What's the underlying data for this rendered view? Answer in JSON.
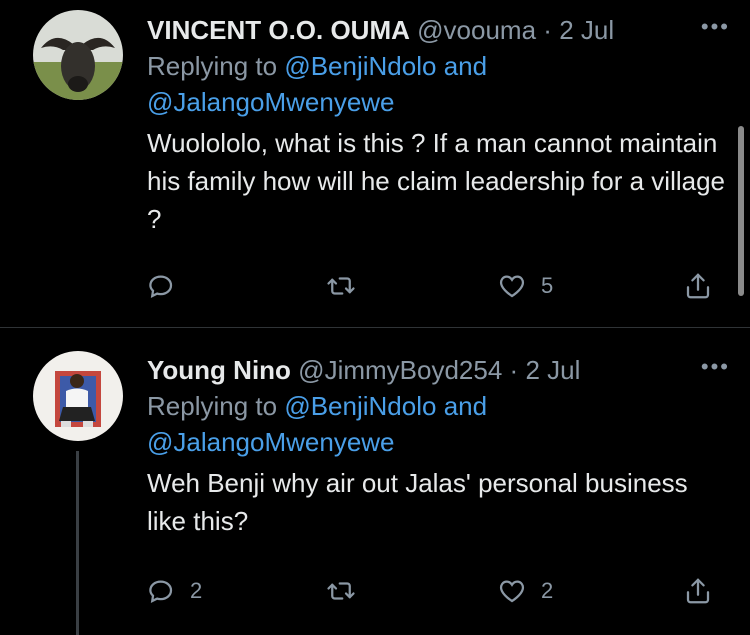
{
  "tweets": [
    {
      "name": "VINCENT O.O. OUMA",
      "handle": "@voouma",
      "separator": "·",
      "date": "2 Jul",
      "more": "•••",
      "replying_prefix": "Replying to",
      "mention1": "@BenjiNdolo",
      "connector": "and",
      "mention2": "@JalangoMwenyewe",
      "text": "Wuolololo, what is this ? If a man cannot maintain his family how will he claim leadership for a village ?",
      "reply_count": "",
      "retweet_count": "",
      "like_count": "5"
    },
    {
      "name": "Young Nino",
      "handle": "@JimmyBoyd254",
      "separator": "·",
      "date": "2 Jul",
      "more": "•••",
      "replying_prefix": "Replying to",
      "mention1": "@BenjiNdolo",
      "connector": "and",
      "mention2": "@JalangoMwenyewe",
      "text": "Weh Benji why air out Jalas' personal business like this?",
      "reply_count": "2",
      "retweet_count": "",
      "like_count": "2"
    }
  ],
  "colors": {
    "background": "#000000",
    "text": "#e7e9ea",
    "muted": "#8b98a5",
    "link": "#4a9fe8",
    "divider": "#2f3336"
  },
  "icons": [
    "reply-icon",
    "retweet-icon",
    "like-icon",
    "share-icon",
    "more-icon"
  ]
}
